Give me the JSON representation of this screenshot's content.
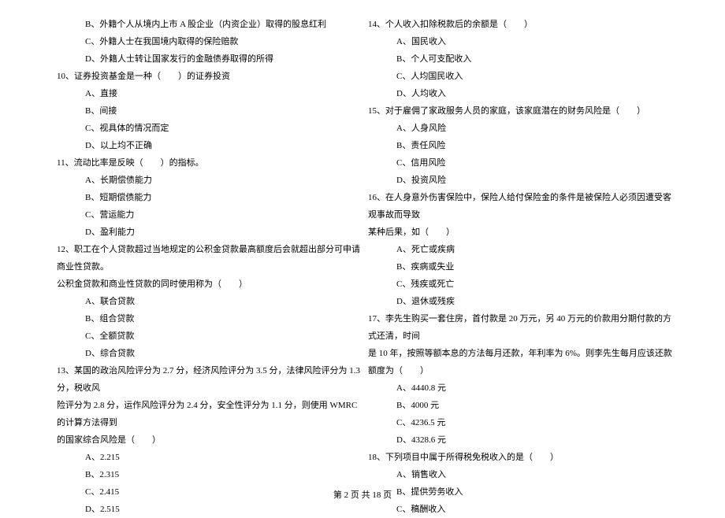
{
  "left": {
    "opt_b": "B、外籍个人从境内上市 A 股企业（内资企业）取得的股息红利",
    "opt_c": "C、外籍人士在我国境内取得的保险赔款",
    "opt_d": "D、外籍人士转让国家发行的金融债券取得的所得",
    "q10": "10、证券投资基金是一种（　　）的证券投资",
    "q10_a": "A、直接",
    "q10_b": "B、间接",
    "q10_c": "C、视具体的情况而定",
    "q10_d": "D、以上均不正确",
    "q11": "11、流动比率是反映（　　）的指标。",
    "q11_a": "A、长期偿债能力",
    "q11_b": "B、短期偿债能力",
    "q11_c": "C、营运能力",
    "q11_d": "D、盈利能力",
    "q12": "12、职工在个人贷款超过当地规定的公积金贷款最高额度后会就超出部分可申请商业性贷款。",
    "q12_line2": "公积金贷款和商业性贷款的同时使用称为（　　）",
    "q12_a": "A、联合贷款",
    "q12_b": "B、组合贷款",
    "q12_c": "C、全额贷款",
    "q12_d": "D、综合贷款",
    "q13": "13、某国的政治风险评分为 2.7 分，经济风险评分为 3.5 分，法律风险评分为 1.3 分，税收风",
    "q13_line2": "险评分为 2.8 分，运作风险评分为 2.4 分，安全性评分为 1.1 分，则使用 WMRC 的计算方法得到",
    "q13_line3": "的国家综合风险是（　　）",
    "q13_a": "A、2.215",
    "q13_b": "B、2.315",
    "q13_c": "C、2.415",
    "q13_d": "D、2.515"
  },
  "right": {
    "q14": "14、个人收入扣除税款后的余额是（　　）",
    "q14_a": "A、国民收入",
    "q14_b": "B、个人可支配收入",
    "q14_c": "C、人均国民收入",
    "q14_d": "D、人均收入",
    "q15": "15、对于雇佣了家政服务人员的家庭，该家庭潜在的财务风险是（　　）",
    "q15_a": "A、人身风险",
    "q15_b": "B、责任风险",
    "q15_c": "C、信用风险",
    "q15_d": "D、投资风险",
    "q16": "16、在人身意外伤害保险中，保险人给付保险金的条件是被保险人必须因遭受客观事故而导致",
    "q16_line2": "某种后果，如（　　）",
    "q16_a": "A、死亡或疾病",
    "q16_b": "B、疾病或失业",
    "q16_c": "C、残疾或死亡",
    "q16_d": "D、退休或残疾",
    "q17": "17、李先生购买一套住房，首付款是 20 万元，另 40 万元的价款用分期付款的方式还清，时间",
    "q17_line2": "是 10 年，按照等额本息的方法每月还款，年利率为 6%。则李先生每月应该还款额度为（　　）",
    "q17_a": "A、4440.8 元",
    "q17_b": "B、4000 元",
    "q17_c": "C、4236.5 元",
    "q17_d": "D、4328.6 元",
    "q18": "18、下列项目中属于所得税免税收入的是（　　）",
    "q18_a": "A、销售收入",
    "q18_b": "B、提供劳务收入",
    "q18_c": "C、稿酬收入"
  },
  "footer": "第 2 页 共 18 页"
}
